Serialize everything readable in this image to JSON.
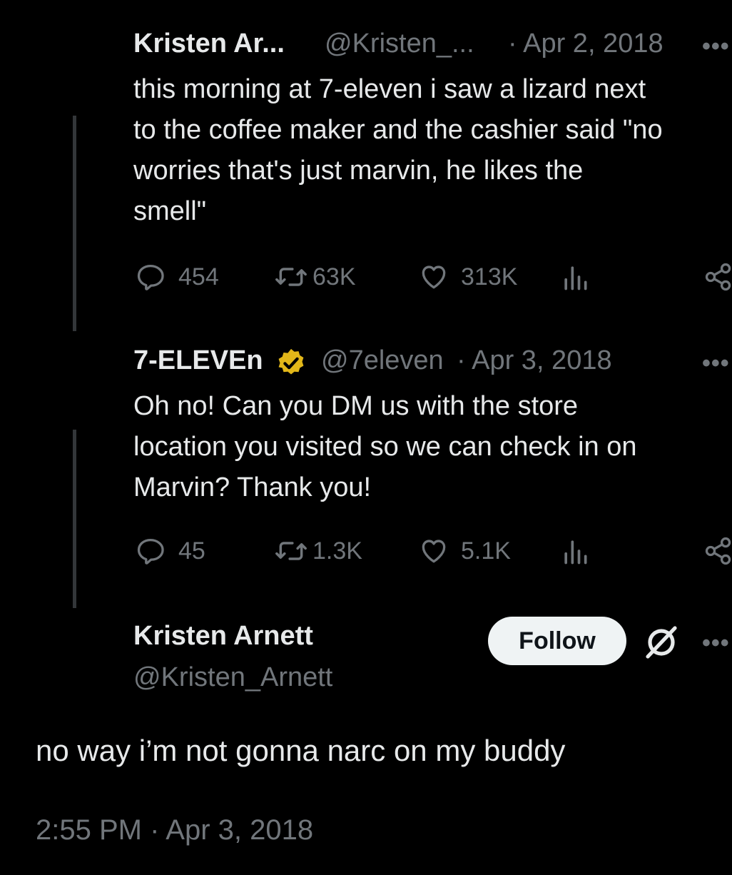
{
  "tweet1": {
    "name": "Kristen Ar...",
    "handle": "@Kristen_...",
    "date": "· Apr 2, 2018",
    "more": "•••",
    "text": "this morning at 7-eleven i saw a lizard next\nto the coffee maker and the cashier said \"no\nworries that's just marvin, he likes the\nsmell\"",
    "replies": "454",
    "reposts": "63K",
    "likes": "313K"
  },
  "tweet2": {
    "name": "7-ELEVEn",
    "handle": "@7eleven",
    "date": "· Apr 3, 2018",
    "more": "•••",
    "text": "Oh no! Can you DM us with the store\nlocation you visited so we can check in on\nMarvin? Thank you!",
    "replies": "45",
    "reposts": "1.3K",
    "likes": "5.1K"
  },
  "main": {
    "name": "Kristen Arnett",
    "handle": "@Kristen_Arnett",
    "follow_label": "Follow",
    "more": "•••",
    "text": "no way i’m not gonna narc on my buddy",
    "timestamp": "2:55 PM · Apr 3, 2018"
  },
  "colors": {
    "background": "#000000",
    "text": "#e7e9ea",
    "muted": "#71767b",
    "verified_gold": "#e2b719",
    "follow_bg": "#eff3f4"
  }
}
